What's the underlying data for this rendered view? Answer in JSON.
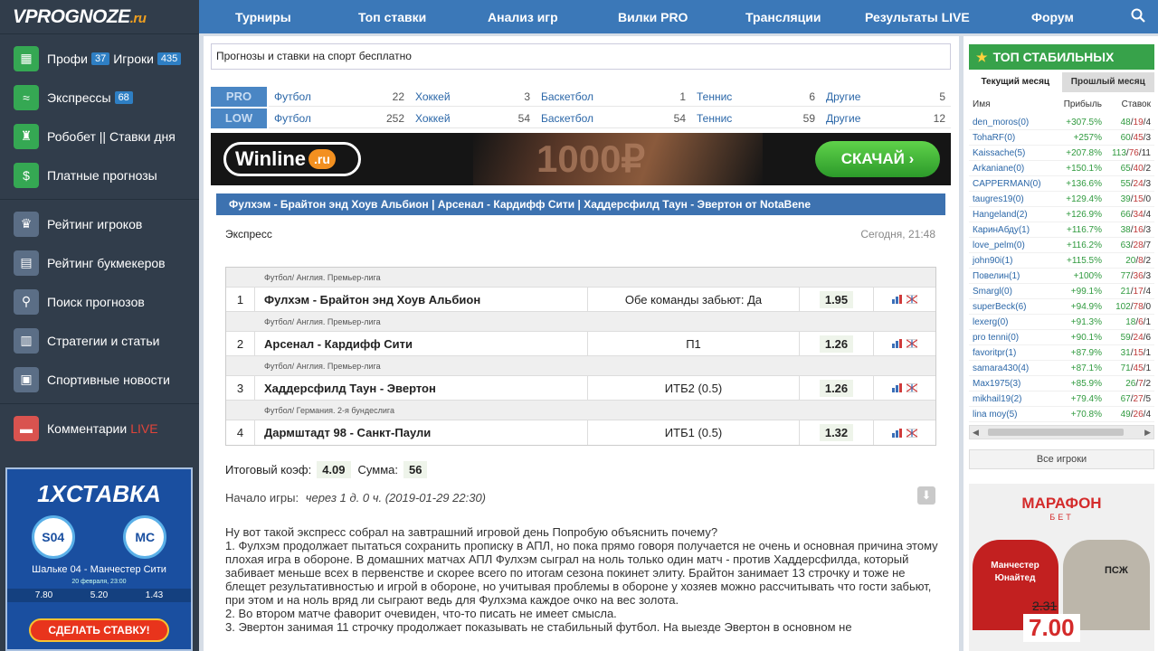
{
  "logo": {
    "text": "VPROGNOZE",
    "suffix": ".ru"
  },
  "sidebar": {
    "group1": [
      {
        "icon": "briefcase-icon",
        "glyph": "▦",
        "label": "Профи",
        "badge": "37",
        "label2": "Игроки",
        "badge2": "435"
      },
      {
        "icon": "express-icon",
        "glyph": "≈",
        "label": "Экспрессы",
        "badge": "68"
      },
      {
        "icon": "robot-icon",
        "glyph": "♜",
        "label": "Робобет || Ставки дня"
      },
      {
        "icon": "dollar-icon",
        "glyph": "$",
        "label": "Платные прогнозы"
      }
    ],
    "group2": [
      {
        "icon": "trophy-icon",
        "glyph": "♛",
        "label": "Рейтинг игроков"
      },
      {
        "icon": "bookmaker-icon",
        "glyph": "▤",
        "label": "Рейтинг букмекеров"
      },
      {
        "icon": "search-icon",
        "glyph": "⚲",
        "label": "Поиск прогнозов"
      },
      {
        "icon": "document-icon",
        "glyph": "▥",
        "label": "Стратегии и статьи"
      },
      {
        "icon": "news-icon",
        "glyph": "▣",
        "label": "Спортивные новости"
      }
    ],
    "comments": {
      "icon": "chat-icon",
      "glyph": "▬",
      "label": "Комментарии",
      "live": "LIVE"
    }
  },
  "promo": {
    "brand": "1XСТАВКА",
    "club1": "S04",
    "club2": "MC",
    "match": "Шальке 04 - Манчестер Сити",
    "date": "20 февраля, 23:00",
    "odds": [
      "7.80",
      "5.20",
      "1.43"
    ],
    "cta": "СДЕЛАТЬ СТАВКУ!"
  },
  "topnav": {
    "items": [
      "Турниры",
      "Топ ставки",
      "Анализ игр",
      "Вилки PRO",
      "Трансляции",
      "Результаты LIVE",
      "Форум"
    ]
  },
  "tagline": "Прогнозы и ставки на спорт бесплатно",
  "sports": {
    "pro": {
      "level": "PRO",
      "items": [
        {
          "name": "Футбол",
          "count": "22"
        },
        {
          "name": "Хоккей",
          "count": "3"
        },
        {
          "name": "Баскетбол",
          "count": "1"
        },
        {
          "name": "Теннис",
          "count": "6"
        },
        {
          "name": "Другие",
          "count": "5"
        }
      ]
    },
    "low": {
      "level": "LOW",
      "items": [
        {
          "name": "Футбол",
          "count": "252"
        },
        {
          "name": "Хоккей",
          "count": "54"
        },
        {
          "name": "Баскетбол",
          "count": "54"
        },
        {
          "name": "Теннис",
          "count": "59"
        },
        {
          "name": "Другие",
          "count": "12"
        }
      ]
    }
  },
  "winline": {
    "logo": "Winline",
    "logo_suffix": ".ru",
    "bg_text": "1000₽",
    "button": "СКАЧАЙ"
  },
  "bet": {
    "title": "Фулхэм - Брайтон энд Хоув Альбион | Арсенал - Кардифф Сити | Хаддерсфилд Таун - Эвертон от NotaBene",
    "type": "Экспресс",
    "time": "Сегодня, 21:48",
    "picks": [
      {
        "league": "Футбол/ Англия. Премьер-лига",
        "num": "1",
        "teams": "Фулхэм - Брайтон энд Хоув Альбион",
        "market": "Обе команды забьют: Да",
        "odd": "1.95"
      },
      {
        "league": "Футбол/ Англия. Премьер-лига",
        "num": "2",
        "teams": "Арсенал - Кардифф Сити",
        "market": "П1",
        "odd": "1.26"
      },
      {
        "league": "Футбол/ Англия. Премьер-лига",
        "num": "3",
        "teams": "Хаддерсфилд Таун - Эвертон",
        "market": "ИТБ2 (0.5)",
        "odd": "1.26"
      },
      {
        "league": "Футбол/ Германия. 2-я бундеслига",
        "num": "4",
        "teams": "Дармштадт 98 - Санкт-Паули",
        "market": "ИТБ1 (0.5)",
        "odd": "1.32"
      }
    ],
    "total_label": "Итоговый коэф:",
    "total_value": "4.09",
    "sum_label": "Сумма:",
    "sum_value": "56",
    "start_label": "Начало игры:",
    "start_value": "через 1 д. 0 ч. (2019-01-29 22:30)",
    "description": [
      "Ну вот такой экспресс собрал на завтрашний игровой день Попробую объяснить почему?",
      "1. Фулхэм продолжает пытаться сохранить прописку в АПЛ, но пока прямо говоря получается не очень и основная причина этому плохая игра в обороне. В домашних матчах АПЛ Фулхэм сыграл на ноль только один матч - против Хаддерсфилда, который забивает меньше всех в первенстве и скорее всего по итогам сезона покинет элиту. Брайтон занимает 13 строчку и тоже не блещет результативностью и игрой в обороне, но учитывая проблемы в обороне у хозяев можно рассчитывать что гости забьют, при этом и на ноль вряд ли сыграют ведь для Фулхэма каждое очко на вес золота.",
      "2. Во втором матче фаворит очевиден, что-то писать не имеет смысла.",
      "3. Эвертон занимая 11 строчку продолжает показывать не стабильный футбол. На выезде Эвертон в основном не"
    ]
  },
  "top": {
    "title": "ТОП СТАБИЛЬНЫХ",
    "tabs": [
      "Текущий месяц",
      "Прошлый месяц"
    ],
    "headers": [
      "Имя",
      "Прибыль",
      "Ставок"
    ],
    "rows": [
      {
        "name": "den_moros(0)",
        "profit": "+307.5%",
        "won": "48",
        "lost": "19",
        "total": "4"
      },
      {
        "name": "TohaRF(0)",
        "profit": "+257%",
        "won": "60",
        "lost": "45",
        "total": "3"
      },
      {
        "name": "Kaissache(5)",
        "profit": "+207.8%",
        "won": "113",
        "lost": "76",
        "total": "11"
      },
      {
        "name": "Arkaniane(0)",
        "profit": "+150.1%",
        "won": "65",
        "lost": "40",
        "total": "2"
      },
      {
        "name": "CAPPERMAN(0)",
        "profit": "+136.6%",
        "won": "55",
        "lost": "24",
        "total": "3"
      },
      {
        "name": "taugres19(0)",
        "profit": "+129.4%",
        "won": "39",
        "lost": "15",
        "total": "0"
      },
      {
        "name": "Hangeland(2)",
        "profit": "+126.9%",
        "won": "66",
        "lost": "34",
        "total": "4"
      },
      {
        "name": "КаринАбду(1)",
        "profit": "+116.7%",
        "won": "38",
        "lost": "16",
        "total": "3"
      },
      {
        "name": "love_pelm(0)",
        "profit": "+116.2%",
        "won": "63",
        "lost": "28",
        "total": "7"
      },
      {
        "name": "john90i(1)",
        "profit": "+115.5%",
        "won": "20",
        "lost": "8",
        "total": "2"
      },
      {
        "name": "Повелин(1)",
        "profit": "+100%",
        "won": "77",
        "lost": "36",
        "total": "3"
      },
      {
        "name": "Smargl(0)",
        "profit": "+99.1%",
        "won": "21",
        "lost": "17",
        "total": "4"
      },
      {
        "name": "superBeck(6)",
        "profit": "+94.9%",
        "won": "102",
        "lost": "78",
        "total": "0"
      },
      {
        "name": "lexerg(0)",
        "profit": "+91.3%",
        "won": "18",
        "lost": "6",
        "total": "1"
      },
      {
        "name": "pro tenni(0)",
        "profit": "+90.1%",
        "won": "59",
        "lost": "24",
        "total": "6"
      },
      {
        "name": "favoritpr(1)",
        "profit": "+87.9%",
        "won": "31",
        "lost": "15",
        "total": "1"
      },
      {
        "name": "samara430(4)",
        "profit": "+87.1%",
        "won": "71",
        "lost": "45",
        "total": "1"
      },
      {
        "name": "Max1975(3)",
        "profit": "+85.9%",
        "won": "26",
        "lost": "7",
        "total": "2"
      },
      {
        "name": "mikhail19(2)",
        "profit": "+79.4%",
        "won": "67",
        "lost": "27",
        "total": "5"
      },
      {
        "name": "lina moy(5)",
        "profit": "+70.8%",
        "won": "49",
        "lost": "26",
        "total": "4"
      }
    ],
    "all_players": "Все игроки"
  },
  "marafon": {
    "logo": "МАРАФОН",
    "bet": "БЕТ",
    "team1": "Манчестер Юнайтед",
    "team2": "ПСЖ",
    "old_odd": "2.31",
    "new_odd": "7.00"
  }
}
